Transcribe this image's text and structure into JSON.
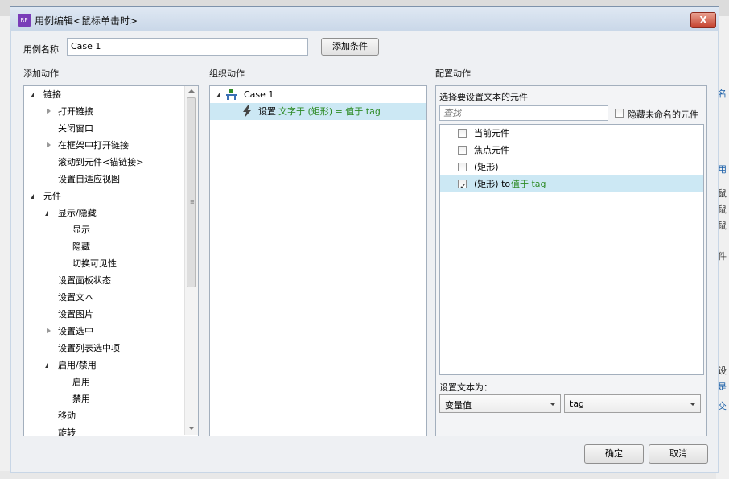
{
  "dialog": {
    "title": "用例编辑<鼠标单击时>",
    "icon_text": "RP",
    "close_label": "X",
    "case_name_label": "用例名称",
    "case_name_value": "Case 1",
    "add_condition_label": "添加条件",
    "ok_label": "确定",
    "cancel_label": "取消"
  },
  "add_actions": {
    "header": "添加动作",
    "items": [
      {
        "label": "链接",
        "level": 0,
        "expander": "open"
      },
      {
        "label": "打开链接",
        "level": 1,
        "expander": "closed"
      },
      {
        "label": "关闭窗口",
        "level": 1,
        "expander": "none"
      },
      {
        "label": "在框架中打开链接",
        "level": 1,
        "expander": "closed"
      },
      {
        "label": "滚动到元件<锚链接>",
        "level": 1,
        "expander": "none"
      },
      {
        "label": "设置自适应视图",
        "level": 1,
        "expander": "none"
      },
      {
        "label": "元件",
        "level": 0,
        "expander": "open"
      },
      {
        "label": "显示/隐藏",
        "level": 1,
        "expander": "open"
      },
      {
        "label": "显示",
        "level": 2,
        "expander": "none"
      },
      {
        "label": "隐藏",
        "level": 2,
        "expander": "none"
      },
      {
        "label": "切换可见性",
        "level": 2,
        "expander": "none"
      },
      {
        "label": "设置面板状态",
        "level": 1,
        "expander": "none"
      },
      {
        "label": "设置文本",
        "level": 1,
        "expander": "none"
      },
      {
        "label": "设置图片",
        "level": 1,
        "expander": "none"
      },
      {
        "label": "设置选中",
        "level": 1,
        "expander": "closed"
      },
      {
        "label": "设置列表选中项",
        "level": 1,
        "expander": "none"
      },
      {
        "label": "启用/禁用",
        "level": 1,
        "expander": "open"
      },
      {
        "label": "启用",
        "level": 2,
        "expander": "none"
      },
      {
        "label": "禁用",
        "level": 2,
        "expander": "none"
      },
      {
        "label": "移动",
        "level": 1,
        "expander": "none"
      },
      {
        "label": "旋转",
        "level": 1,
        "expander": "none"
      }
    ]
  },
  "organize_actions": {
    "header": "组织动作",
    "case_label": "Case 1",
    "action_prefix": "设置",
    "action_detail": "文字于 (矩形) = 值于 tag"
  },
  "configure_actions": {
    "header": "配置动作",
    "select_label": "选择要设置文本的元件",
    "search_placeholder": "查找",
    "hide_unnamed_label": "隐藏未命名的元件",
    "widgets": [
      {
        "label": "当前元件",
        "checked": false,
        "suffix": ""
      },
      {
        "label": "焦点元件",
        "checked": false,
        "suffix": ""
      },
      {
        "label": "(矩形)",
        "checked": false,
        "suffix": ""
      },
      {
        "label": "(矩形) to",
        "checked": true,
        "suffix": "值于 tag"
      }
    ],
    "set_text_label": "设置文本为：",
    "type_value": "变量值",
    "variable_value": "tag"
  },
  "background": {
    "right_fragments": [
      "名",
      "用",
      "鼠",
      "鼠",
      "鼠",
      "件",
      "设",
      "是",
      "交"
    ]
  },
  "colors": {
    "selection": "#cce8f4",
    "value_text": "#2e8b26",
    "title_icon": "#7a3db8"
  }
}
